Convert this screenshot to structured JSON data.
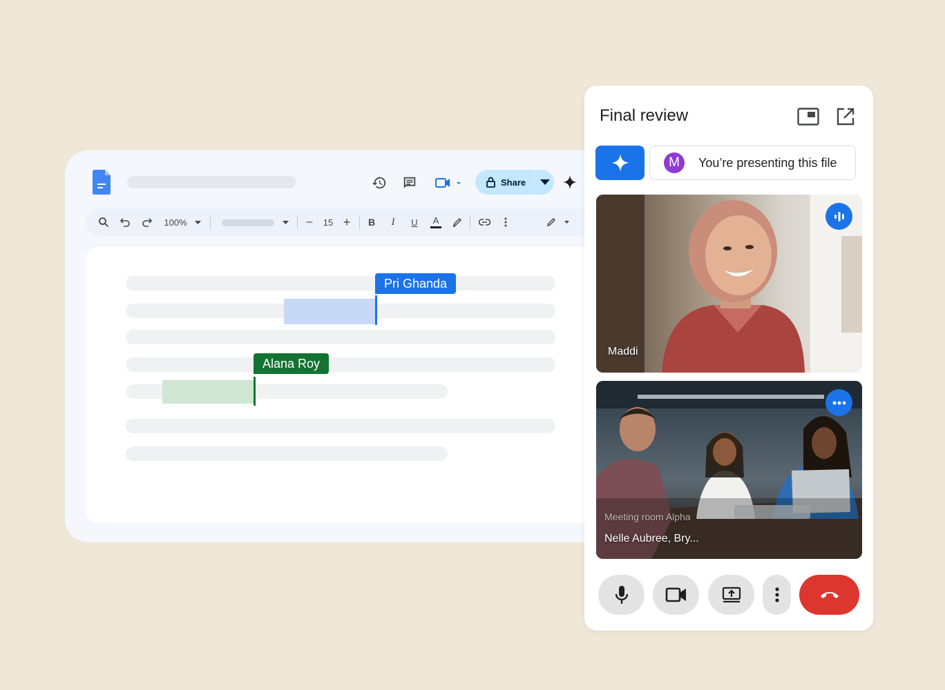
{
  "docs": {
    "zoom": "100%",
    "font_size": "15",
    "share_label": "Share",
    "collaborators": [
      {
        "name": "Pri Ghanda",
        "color": "#1a73e8"
      },
      {
        "name": "Alana Roy",
        "color": "#137333"
      }
    ],
    "icons": {
      "toolbar_top": [
        "docs-logo-icon",
        "history-icon",
        "comment-icon",
        "meet-video-icon",
        "lock-icon",
        "gemini-icon"
      ],
      "toolbar_format": [
        "search-icon",
        "undo-icon",
        "redo-icon",
        "bold-icon",
        "italic-icon",
        "underline-icon",
        "text-color-icon",
        "highlight-icon",
        "link-icon",
        "more-icon",
        "edit-mode-icon"
      ]
    },
    "toolbar_glyphs": {
      "minus": "–",
      "plus": "+",
      "bold": "B",
      "italic": "I",
      "underline": "U",
      "text_color": "A"
    }
  },
  "meet": {
    "title": "Final review",
    "presenting_avatar_letter": "M",
    "presenting_text": "You’re presenting this file",
    "tiles": [
      {
        "name": "Maddi",
        "badge": "speaking-indicator-icon"
      },
      {
        "room": "Meeting room Alpha",
        "name": "Nelle Aubree, Bry...",
        "badge": "more-options-icon"
      }
    ],
    "controls": [
      "microphone-icon",
      "camera-icon",
      "present-screen-icon",
      "more-vert-icon",
      "end-call-icon"
    ],
    "accent": "#1a73e8",
    "end_call_color": "#dc362e"
  }
}
